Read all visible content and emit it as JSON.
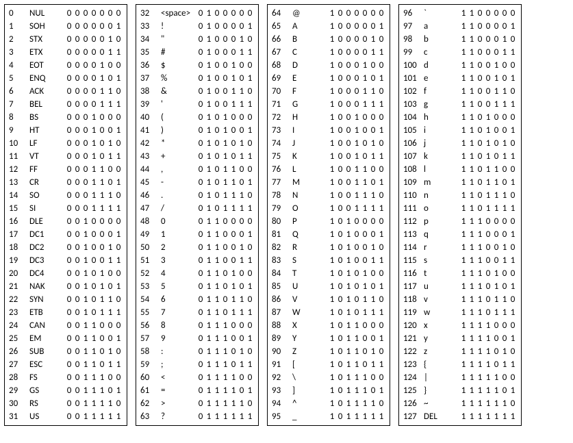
{
  "columns": [
    [
      {
        "dec": 0,
        "char": "NUL",
        "bits": "0000000"
      },
      {
        "dec": 1,
        "char": "SOH",
        "bits": "0000001"
      },
      {
        "dec": 2,
        "char": "STX",
        "bits": "0000010"
      },
      {
        "dec": 3,
        "char": "ETX",
        "bits": "0000011"
      },
      {
        "dec": 4,
        "char": "EOT",
        "bits": "0000100"
      },
      {
        "dec": 5,
        "char": "ENQ",
        "bits": "0000101"
      },
      {
        "dec": 6,
        "char": "ACK",
        "bits": "0000110"
      },
      {
        "dec": 7,
        "char": "BEL",
        "bits": "0000111"
      },
      {
        "dec": 8,
        "char": "BS",
        "bits": "0001000"
      },
      {
        "dec": 9,
        "char": "HT",
        "bits": "0001001"
      },
      {
        "dec": 10,
        "char": "LF",
        "bits": "0001010"
      },
      {
        "dec": 11,
        "char": "VT",
        "bits": "0001011"
      },
      {
        "dec": 12,
        "char": "FF",
        "bits": "0001100"
      },
      {
        "dec": 13,
        "char": "CR",
        "bits": "0001101"
      },
      {
        "dec": 14,
        "char": "SO",
        "bits": "0001110"
      },
      {
        "dec": 15,
        "char": "SI",
        "bits": "0001111"
      },
      {
        "dec": 16,
        "char": "DLE",
        "bits": "0010000"
      },
      {
        "dec": 17,
        "char": "DC1",
        "bits": "0010001"
      },
      {
        "dec": 18,
        "char": "DC2",
        "bits": "0010010"
      },
      {
        "dec": 19,
        "char": "DC3",
        "bits": "0010011"
      },
      {
        "dec": 20,
        "char": "DC4",
        "bits": "0010100"
      },
      {
        "dec": 21,
        "char": "NAK",
        "bits": "0010101"
      },
      {
        "dec": 22,
        "char": "SYN",
        "bits": "0010110"
      },
      {
        "dec": 23,
        "char": "ETB",
        "bits": "0010111"
      },
      {
        "dec": 24,
        "char": "CAN",
        "bits": "0011000"
      },
      {
        "dec": 25,
        "char": "EM",
        "bits": "0011001"
      },
      {
        "dec": 26,
        "char": "SUB",
        "bits": "0011010"
      },
      {
        "dec": 27,
        "char": "ESC",
        "bits": "0011011"
      },
      {
        "dec": 28,
        "char": "FS",
        "bits": "0011100"
      },
      {
        "dec": 29,
        "char": "GS",
        "bits": "0011101"
      },
      {
        "dec": 30,
        "char": "RS",
        "bits": "0011110"
      },
      {
        "dec": 31,
        "char": "US",
        "bits": "0011111"
      }
    ],
    [
      {
        "dec": 32,
        "char": "<space>",
        "bits": "0100000"
      },
      {
        "dec": 33,
        "char": "!",
        "bits": "0100001"
      },
      {
        "dec": 34,
        "char": "\"",
        "bits": "0100010"
      },
      {
        "dec": 35,
        "char": "#",
        "bits": "0100011"
      },
      {
        "dec": 36,
        "char": "$",
        "bits": "0100100"
      },
      {
        "dec": 37,
        "char": "%",
        "bits": "0100101"
      },
      {
        "dec": 38,
        "char": "&",
        "bits": "0100110"
      },
      {
        "dec": 39,
        "char": "'",
        "bits": "0100111"
      },
      {
        "dec": 40,
        "char": "(",
        "bits": "0101000"
      },
      {
        "dec": 41,
        "char": ")",
        "bits": "0101001"
      },
      {
        "dec": 42,
        "char": "*",
        "bits": "0101010"
      },
      {
        "dec": 43,
        "char": "+",
        "bits": "0101011"
      },
      {
        "dec": 44,
        "char": ",",
        "bits": "0101100"
      },
      {
        "dec": 45,
        "char": "-",
        "bits": "0101101"
      },
      {
        "dec": 46,
        "char": ".",
        "bits": "0101110"
      },
      {
        "dec": 47,
        "char": "/",
        "bits": "0101111"
      },
      {
        "dec": 48,
        "char": "0",
        "bits": "0110000"
      },
      {
        "dec": 49,
        "char": "1",
        "bits": "0110001"
      },
      {
        "dec": 50,
        "char": "2",
        "bits": "0110010"
      },
      {
        "dec": 51,
        "char": "3",
        "bits": "0110011"
      },
      {
        "dec": 52,
        "char": "4",
        "bits": "0110100"
      },
      {
        "dec": 53,
        "char": "5",
        "bits": "0110101"
      },
      {
        "dec": 54,
        "char": "6",
        "bits": "0110110"
      },
      {
        "dec": 55,
        "char": "7",
        "bits": "0110111"
      },
      {
        "dec": 56,
        "char": "8",
        "bits": "0111000"
      },
      {
        "dec": 57,
        "char": "9",
        "bits": "0111001"
      },
      {
        "dec": 58,
        "char": ":",
        "bits": "0111010"
      },
      {
        "dec": 59,
        "char": ";",
        "bits": "0111011"
      },
      {
        "dec": 60,
        "char": "<",
        "bits": "0111100"
      },
      {
        "dec": 61,
        "char": "=",
        "bits": "0111101"
      },
      {
        "dec": 62,
        "char": ">",
        "bits": "0111110"
      },
      {
        "dec": 63,
        "char": "?",
        "bits": "0111111"
      }
    ],
    [
      {
        "dec": 64,
        "char": "@",
        "bits": "1000000"
      },
      {
        "dec": 65,
        "char": "A",
        "bits": "1000001"
      },
      {
        "dec": 66,
        "char": "B",
        "bits": "1000010"
      },
      {
        "dec": 67,
        "char": "C",
        "bits": "1000011"
      },
      {
        "dec": 68,
        "char": "D",
        "bits": "1000100"
      },
      {
        "dec": 69,
        "char": "E",
        "bits": "1000101"
      },
      {
        "dec": 70,
        "char": "F",
        "bits": "1000110"
      },
      {
        "dec": 71,
        "char": "G",
        "bits": "1000111"
      },
      {
        "dec": 72,
        "char": "H",
        "bits": "1001000"
      },
      {
        "dec": 73,
        "char": "I",
        "bits": "1001001"
      },
      {
        "dec": 74,
        "char": "J",
        "bits": "1001010"
      },
      {
        "dec": 75,
        "char": "K",
        "bits": "1001011"
      },
      {
        "dec": 76,
        "char": "L",
        "bits": "1001100"
      },
      {
        "dec": 77,
        "char": "M",
        "bits": "1001101"
      },
      {
        "dec": 78,
        "char": "N",
        "bits": "1001110"
      },
      {
        "dec": 79,
        "char": "O",
        "bits": "1001111"
      },
      {
        "dec": 80,
        "char": "P",
        "bits": "1010000"
      },
      {
        "dec": 81,
        "char": "Q",
        "bits": "1010001"
      },
      {
        "dec": 82,
        "char": "R",
        "bits": "1010010"
      },
      {
        "dec": 83,
        "char": "S",
        "bits": "1010011"
      },
      {
        "dec": 84,
        "char": "T",
        "bits": "1010100"
      },
      {
        "dec": 85,
        "char": "U",
        "bits": "1010101"
      },
      {
        "dec": 86,
        "char": "V",
        "bits": "1010110"
      },
      {
        "dec": 87,
        "char": "W",
        "bits": "1010111"
      },
      {
        "dec": 88,
        "char": "X",
        "bits": "1011000"
      },
      {
        "dec": 89,
        "char": "Y",
        "bits": "1011001"
      },
      {
        "dec": 90,
        "char": "Z",
        "bits": "1011010"
      },
      {
        "dec": 91,
        "char": "[",
        "bits": "1011011"
      },
      {
        "dec": 92,
        "char": "\\",
        "bits": "1011100"
      },
      {
        "dec": 93,
        "char": "]",
        "bits": "1011101"
      },
      {
        "dec": 94,
        "char": "^",
        "bits": "1011110"
      },
      {
        "dec": 95,
        "char": "_",
        "bits": "1011111"
      }
    ],
    [
      {
        "dec": 96,
        "char": "`",
        "bits": "1100000"
      },
      {
        "dec": 97,
        "char": "a",
        "bits": "1100001"
      },
      {
        "dec": 98,
        "char": "b",
        "bits": "1100010"
      },
      {
        "dec": 99,
        "char": "c",
        "bits": "1100011"
      },
      {
        "dec": 100,
        "char": "d",
        "bits": "1100100"
      },
      {
        "dec": 101,
        "char": "e",
        "bits": "1100101"
      },
      {
        "dec": 102,
        "char": "f",
        "bits": "1100110"
      },
      {
        "dec": 103,
        "char": "g",
        "bits": "1100111"
      },
      {
        "dec": 104,
        "char": "h",
        "bits": "1101000"
      },
      {
        "dec": 105,
        "char": "i",
        "bits": "1101001"
      },
      {
        "dec": 106,
        "char": "j",
        "bits": "1101010"
      },
      {
        "dec": 107,
        "char": "k",
        "bits": "1101011"
      },
      {
        "dec": 108,
        "char": "l",
        "bits": "1101100"
      },
      {
        "dec": 109,
        "char": "m",
        "bits": "1101101"
      },
      {
        "dec": 110,
        "char": "n",
        "bits": "1101110"
      },
      {
        "dec": 111,
        "char": "o",
        "bits": "1101111"
      },
      {
        "dec": 112,
        "char": "p",
        "bits": "1110000"
      },
      {
        "dec": 113,
        "char": "q",
        "bits": "1110001"
      },
      {
        "dec": 114,
        "char": "r",
        "bits": "1110010"
      },
      {
        "dec": 115,
        "char": "s",
        "bits": "1110011"
      },
      {
        "dec": 116,
        "char": "t",
        "bits": "1110100"
      },
      {
        "dec": 117,
        "char": "u",
        "bits": "1110101"
      },
      {
        "dec": 118,
        "char": "v",
        "bits": "1110110"
      },
      {
        "dec": 119,
        "char": "w",
        "bits": "1110111"
      },
      {
        "dec": 120,
        "char": "x",
        "bits": "1111000"
      },
      {
        "dec": 121,
        "char": "y",
        "bits": "1111001"
      },
      {
        "dec": 122,
        "char": "z",
        "bits": "1111010"
      },
      {
        "dec": 123,
        "char": "{",
        "bits": "1111011"
      },
      {
        "dec": 124,
        "char": "|",
        "bits": "1111100"
      },
      {
        "dec": 125,
        "char": "}",
        "bits": "1111101"
      },
      {
        "dec": 126,
        "char": "~",
        "bits": "1111110"
      },
      {
        "dec": 127,
        "char": "DEL",
        "bits": "1111111"
      }
    ]
  ]
}
